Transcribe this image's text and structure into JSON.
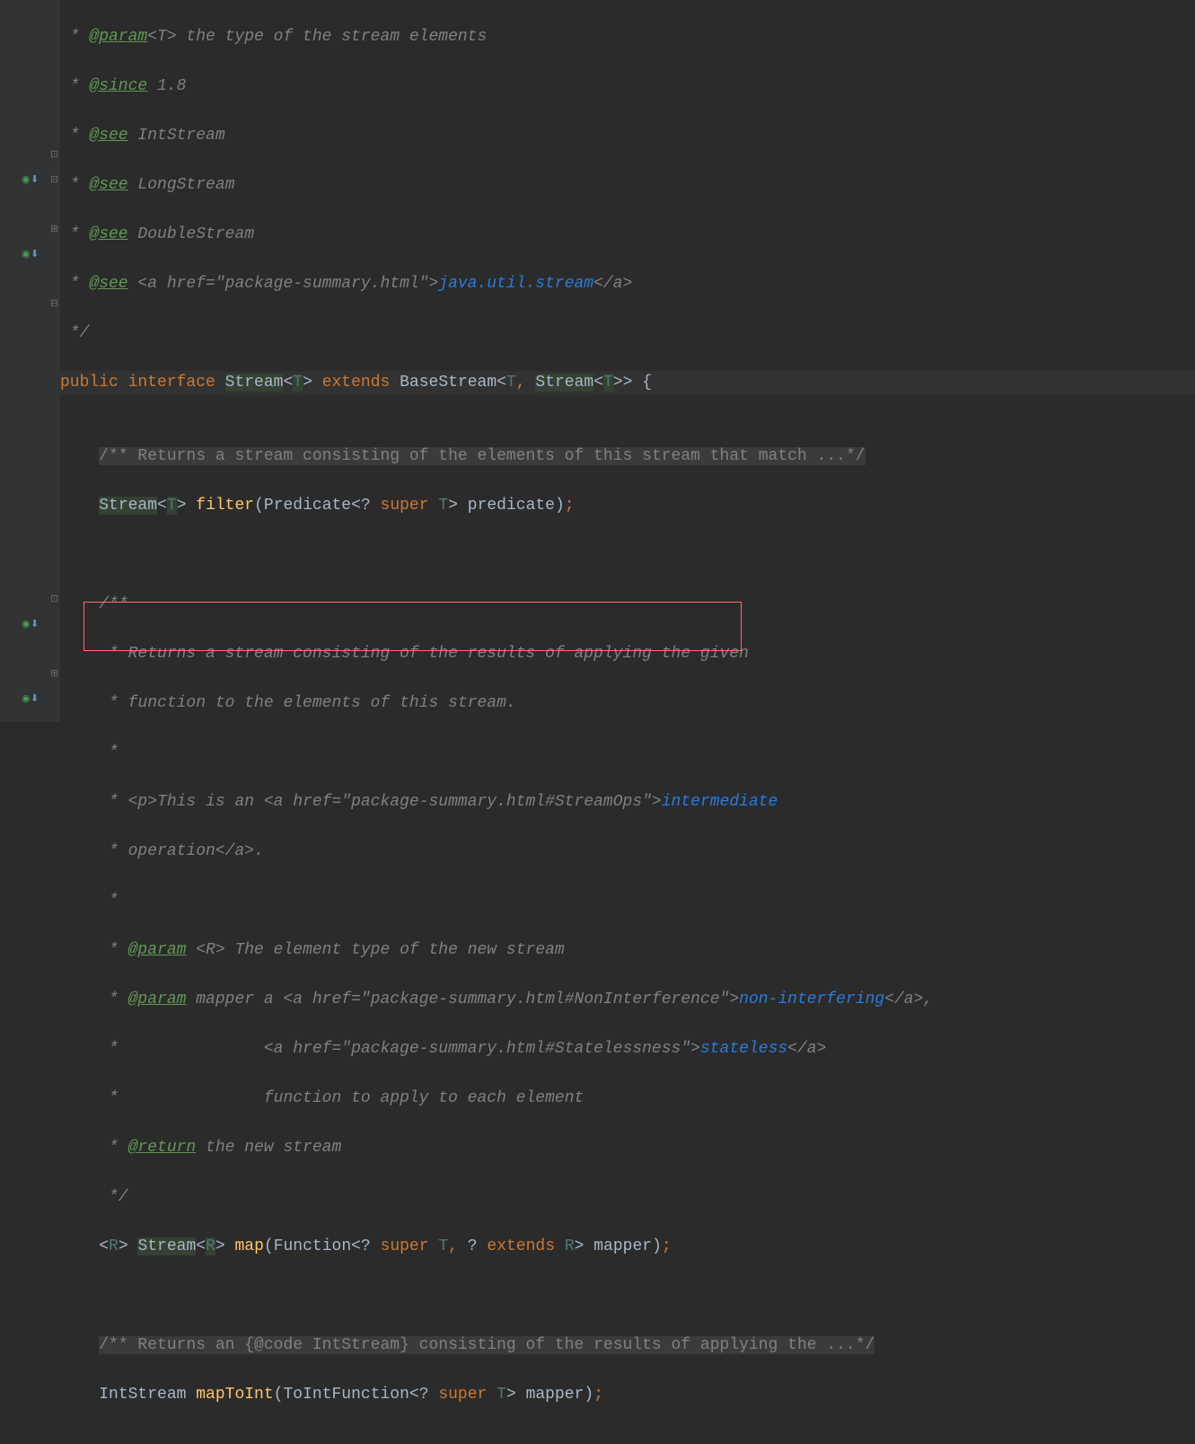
{
  "gutter": {
    "impl_arrow": "⬇",
    "impl_circle": "◉",
    "fold_minus": "⊟",
    "fold_plus": "⊞",
    "fold_end": "⊡"
  },
  "doc": {
    "param_tag": "@param",
    "since_tag": "@since",
    "see_tag": "@see",
    "return_tag": "@return",
    "T_generic": "<T>",
    "param_T_desc": " the type of the stream elements",
    "since_val": " 1.8",
    "see_int": " IntStream",
    "see_long": " LongStream",
    "see_double": " DoubleStream",
    "see_a_open": " <a href=\"package-summary.html\">",
    "see_pkg": "java.util.stream",
    "see_a_close": "</a>",
    "end": "*/",
    "filter_folded": "/** Returns a stream consisting of the elements of this stream that match ...*/",
    "map_l1": "/**",
    "map_l2": " * Returns a stream consisting of the results of applying the given",
    "map_l3": " * function to the elements of this stream.",
    "star": " *",
    "map_l5a": " * <p>",
    "map_l5b": "This is an ",
    "map_l5c": "<a href=\"package-summary.html#StreamOps\">",
    "map_l5d": "intermediate",
    "map_l6a": " * operation",
    "map_l6b": "</a>.",
    "map_pR": " <R>",
    "map_pR_desc": " The element type of the new stream",
    "map_mapper": " mapper a ",
    "map_ni_open": "<a href=\"package-summary.html#NonInterference\">",
    "map_ni": "non-interfering",
    "map_ni_close": "</a>,",
    "map_sl_pre": " *               ",
    "map_sl_open": "<a href=\"package-summary.html#Statelessness\">",
    "map_sl": "stateless",
    "map_sl_close": "</a>",
    "map_fn": " *               function to apply to each element",
    "map_ret": " the new stream",
    "maptoint_folded": "/** Returns an {@code IntStream} consisting of the results of applying the ...*/"
  },
  "code": {
    "public": "public",
    "interface": "interface",
    "extends": "extends",
    "super": "super",
    "Stream": "Stream",
    "BaseStream": "BaseStream",
    "T": "T",
    "R": "R",
    "filter": "filter",
    "Predicate": "Predicate",
    "predicate": "predicate",
    "map": "map",
    "Function": "Function",
    "mapper": "mapper",
    "IntStream": "IntStream",
    "mapToInt": "mapToInt",
    "ToIntFunction": "ToIntFunction"
  }
}
